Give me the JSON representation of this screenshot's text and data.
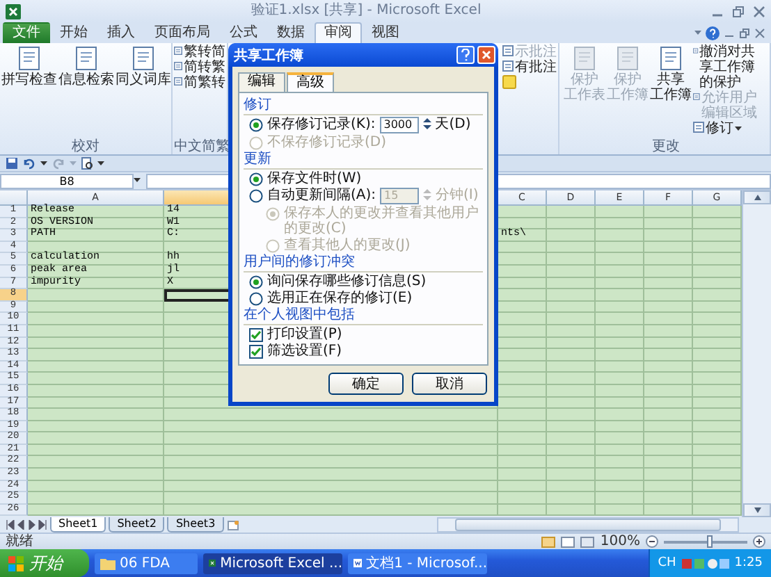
{
  "window": {
    "title": "验证1.xlsx [共享] - Microsoft Excel"
  },
  "ribbon_tabs": [
    {
      "label": "文件",
      "kind": "file",
      "selected": false
    },
    {
      "label": "开始",
      "kind": "tab",
      "selected": false
    },
    {
      "label": "插入",
      "kind": "tab",
      "selected": false
    },
    {
      "label": "页面布局",
      "kind": "tab",
      "selected": false
    },
    {
      "label": "公式",
      "kind": "tab",
      "selected": false
    },
    {
      "label": "数据",
      "kind": "tab",
      "selected": false
    },
    {
      "label": "审阅",
      "kind": "tab",
      "selected": true
    },
    {
      "label": "视图",
      "kind": "tab",
      "selected": false
    }
  ],
  "ribbon": {
    "left_groups": [
      {
        "label": "校对",
        "items": [
          {
            "kind": "large",
            "lines": [
              "拼写检查"
            ],
            "disabled": false
          },
          {
            "kind": "large",
            "lines": [
              "信息检索"
            ],
            "disabled": false
          },
          {
            "kind": "large",
            "lines": [
              "同义词库"
            ],
            "disabled": false
          }
        ]
      },
      {
        "label": "中文简繁",
        "items": [
          {
            "kind": "small",
            "label": "繁转简",
            "disabled": false
          },
          {
            "kind": "small",
            "label": "简转繁",
            "disabled": false
          },
          {
            "kind": "small",
            "label": "简繁转",
            "disabled": false
          }
        ]
      }
    ],
    "right_groups": [
      {
        "items": [
          {
            "kind": "small",
            "label": "示批注",
            "disabled": true
          },
          {
            "kind": "small",
            "label": "有批注",
            "disabled": false
          },
          {
            "kind": "icon",
            "disabled": false
          }
        ]
      },
      {
        "label": "更改",
        "items": [
          {
            "kind": "large",
            "lines": [
              "保护",
              "工作表"
            ],
            "disabled": true
          },
          {
            "kind": "large",
            "lines": [
              "保护",
              "工作簿"
            ],
            "disabled": true
          },
          {
            "kind": "large",
            "lines": [
              "共享",
              "工作簿"
            ],
            "disabled": false
          },
          {
            "kind": "small",
            "label": "撤消对共享工作簿的保护",
            "disabled": false
          },
          {
            "kind": "small",
            "label": "允许用户编辑区域",
            "disabled": true
          },
          {
            "kind": "small",
            "label": "修订",
            "disabled": false,
            "dropdown": true
          }
        ]
      }
    ]
  },
  "formula_bar": {
    "name_box": "B8"
  },
  "grid": {
    "columns": [
      {
        "label": "A",
        "selected": false
      },
      {
        "selected": true
      },
      {
        "label": "C",
        "selected": false
      },
      {
        "label": "D",
        "selected": false
      },
      {
        "label": "E",
        "selected": false
      },
      {
        "label": "F",
        "selected": false
      },
      {
        "label": "G",
        "selected": false
      }
    ],
    "rows": [
      {
        "number": "1",
        "a": "Release",
        "b": "14",
        "selected": false
      },
      {
        "number": "2",
        "a": "OS VERSION",
        "b": "W1",
        "selected": false
      },
      {
        "number": "3",
        "a": "PATH",
        "b": "C:",
        "c": "nts\\",
        "selected": false
      },
      {
        "number": "4",
        "selected": false
      },
      {
        "number": "5",
        "a": "calculation",
        "b": "hh",
        "selected": false
      },
      {
        "number": "6",
        "a": "peak area",
        "b": "jl",
        "selected": false
      },
      {
        "number": "7",
        "a": "impurity",
        "b": "X",
        "selected": false
      },
      {
        "number": "8",
        "selected": true
      },
      {
        "number": "9",
        "selected": false
      },
      {
        "number": "10",
        "selected": false
      },
      {
        "number": "11",
        "selected": false
      },
      {
        "number": "12",
        "selected": false
      },
      {
        "number": "13",
        "selected": false
      },
      {
        "number": "14",
        "selected": false
      },
      {
        "number": "15",
        "selected": false
      },
      {
        "number": "16",
        "selected": false
      },
      {
        "number": "17",
        "selected": false
      },
      {
        "number": "18",
        "selected": false
      },
      {
        "number": "19",
        "selected": false
      },
      {
        "number": "20",
        "selected": false
      },
      {
        "number": "21",
        "selected": false
      },
      {
        "number": "22",
        "selected": false
      },
      {
        "number": "23",
        "selected": false
      },
      {
        "number": "24",
        "selected": false
      },
      {
        "number": "25",
        "selected": false
      },
      {
        "number": "26",
        "selected": false
      }
    ]
  },
  "sheet_tabs": [
    {
      "label": "Sheet1",
      "selected": true
    },
    {
      "label": "Sheet2",
      "selected": false
    },
    {
      "label": "Sheet3",
      "selected": false
    }
  ],
  "status_bar": {
    "text": "就绪",
    "zoom": "100%",
    "level": 0.55
  },
  "dialog": {
    "title": "共享工作簿",
    "tabs": [
      {
        "label": "编辑",
        "selected": false
      },
      {
        "label": "高级",
        "selected": true
      }
    ],
    "sections": [
      {
        "label": "修订",
        "options": [
          {
            "kind": "radio",
            "label": "保存修订记录(K):",
            "selected": true,
            "disabled": false,
            "field": "3000",
            "field_disabled": false,
            "unit": "天(D)"
          },
          {
            "kind": "radio",
            "label": "不保存修订记录(D)",
            "selected": false,
            "disabled": true
          }
        ]
      },
      {
        "label": "更新",
        "options": [
          {
            "kind": "radio",
            "label": "保存文件时(W)",
            "selected": true,
            "disabled": false
          },
          {
            "kind": "radio",
            "label": "自动更新间隔(A):",
            "selected": false,
            "disabled": false,
            "field": "15",
            "field_disabled": true,
            "unit": "分钟(I)"
          },
          {
            "kind": "subradio",
            "label": "保存本人的更改并查看其他用户的更改(C)",
            "selected": true,
            "disabled": true
          },
          {
            "kind": "subradio",
            "label": "查看其他人的更改(J)",
            "selected": false,
            "disabled": true
          }
        ]
      },
      {
        "label": "用户间的修订冲突",
        "options": [
          {
            "kind": "radio",
            "label": "询问保存哪些修订信息(S)",
            "selected": true,
            "disabled": false
          },
          {
            "kind": "radio",
            "label": "选用正在保存的修订(E)",
            "selected": false,
            "disabled": false
          }
        ]
      },
      {
        "label": "在个人视图中包括",
        "options": [
          {
            "kind": "checkbox",
            "label": "打印设置(P)",
            "checked": true,
            "disabled": false
          },
          {
            "kind": "checkbox",
            "label": "筛选设置(F)",
            "checked": true,
            "disabled": false
          }
        ]
      }
    ],
    "buttons": [
      "确定",
      "取消"
    ]
  },
  "taskbar": {
    "start": "开始",
    "items": [
      {
        "label": "06 FDA",
        "kind": "folder",
        "selected": false
      },
      {
        "label": "Microsoft Excel ...",
        "kind": "excel",
        "selected": true
      },
      {
        "label": "文档1 - Microsof...",
        "kind": "word",
        "selected": false
      }
    ],
    "language": "CH",
    "time": "1:25"
  }
}
